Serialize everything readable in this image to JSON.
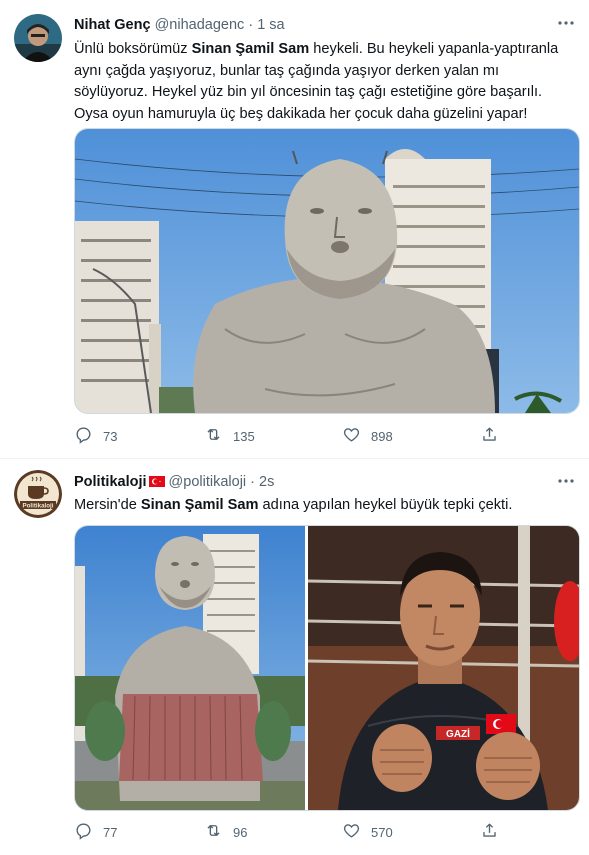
{
  "tweet1": {
    "name": "Nihat Genç",
    "handle": "@nihadagenc",
    "sep": "·",
    "time": "1 sa",
    "text_pre": "Ünlü boksörümüz ",
    "text_bold": "Sinan Şamil Sam",
    "text_post": " heykeli. Bu heykeli yapanla-yaptıranla aynı çağda yaşıyoruz, bunlar taş çağında yaşıyor derken yalan mı söylüyoruz. Heykel yüz bin yıl öncesinin taş çağı estetiğine göre başarılı. Oysa oyun hamuruyla üç beş dakikada her çocuk daha güzelini yapar!",
    "replies": "73",
    "retweets": "135",
    "likes": "898"
  },
  "tweet2": {
    "name": "Politikaloji",
    "handle": "@politikaloji",
    "sep": "·",
    "time": "2s",
    "avatar_text": "Politikaloji",
    "text_pre": "Mersin'de ",
    "text_bold": "Sinan Şamil Sam",
    "text_post": " adına yapılan heykel büyük tepki çekti.",
    "jersey_text": "GAZİ",
    "replies": "77",
    "retweets": "96",
    "likes": "570"
  },
  "icons": {
    "reply": "reply-icon",
    "retweet": "retweet-icon",
    "like": "heart-icon",
    "share": "share-icon",
    "more": "more-icon"
  },
  "colors": {
    "text": "#0f1419",
    "secondary": "#536471",
    "flag_red": "#e30a17"
  }
}
